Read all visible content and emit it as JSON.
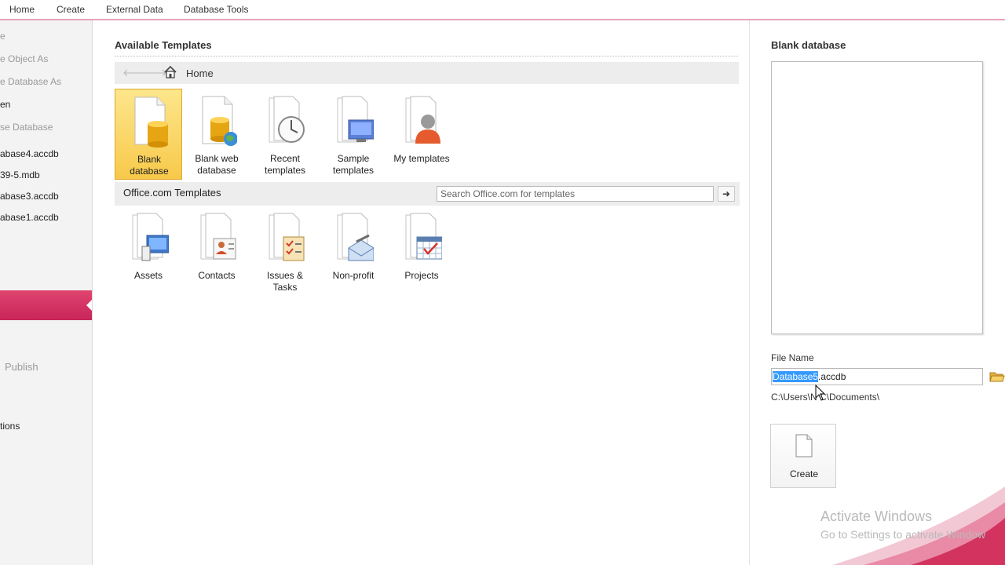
{
  "ribbon": {
    "tabs": [
      "Home",
      "Create",
      "External Data",
      "Database Tools"
    ]
  },
  "leftnav": {
    "items": [
      {
        "label": "e"
      },
      {
        "label": "e Object As"
      },
      {
        "label": "e Database As"
      },
      {
        "label": "en"
      },
      {
        "label": "se Database"
      },
      {
        "label": "abase4.accdb"
      },
      {
        "label": "39-5.mdb"
      },
      {
        "label": "abase3.accdb"
      },
      {
        "label": "abase1.accdb"
      },
      {
        "label": "Publish"
      },
      {
        "label": "tions"
      }
    ]
  },
  "main": {
    "title": "Available Templates",
    "nav": {
      "back_icon": "back-arrow",
      "forward_icon": "forward-arrow",
      "home_label": "Home"
    },
    "tiles": [
      {
        "label": "Blank\ndatabase",
        "icon": "blank-database-icon"
      },
      {
        "label": "Blank web\ndatabase",
        "icon": "blank-web-database-icon"
      },
      {
        "label": "Recent\ntemplates",
        "icon": "recent-templates-icon"
      },
      {
        "label": "Sample\ntemplates",
        "icon": "sample-templates-icon"
      },
      {
        "label": "My templates",
        "icon": "my-templates-icon"
      }
    ],
    "office": {
      "title": "Office.com Templates",
      "search_placeholder": "Search Office.com for templates",
      "go_label": "➜"
    },
    "office_tiles": [
      {
        "label": "Assets",
        "icon": "assets-icon"
      },
      {
        "label": "Contacts",
        "icon": "contacts-icon"
      },
      {
        "label": "Issues &\nTasks",
        "icon": "issues-tasks-icon"
      },
      {
        "label": "Non-profit",
        "icon": "non-profit-icon"
      },
      {
        "label": "Projects",
        "icon": "projects-icon"
      }
    ]
  },
  "right": {
    "title": "Blank database",
    "file_name_label": "File Name",
    "file_name_selected": "Database5",
    "file_name_rest": ".accdb",
    "path": "C:\\Users\\N  C\\Documents\\",
    "create_label": "Create"
  },
  "watermark": {
    "line1": "Activate Windows",
    "line2": "Go to Settings to activate Window"
  },
  "colors": {
    "accent": "#d2335f",
    "selected_tile": "#f7c94a",
    "selection_highlight": "#3399ff"
  }
}
